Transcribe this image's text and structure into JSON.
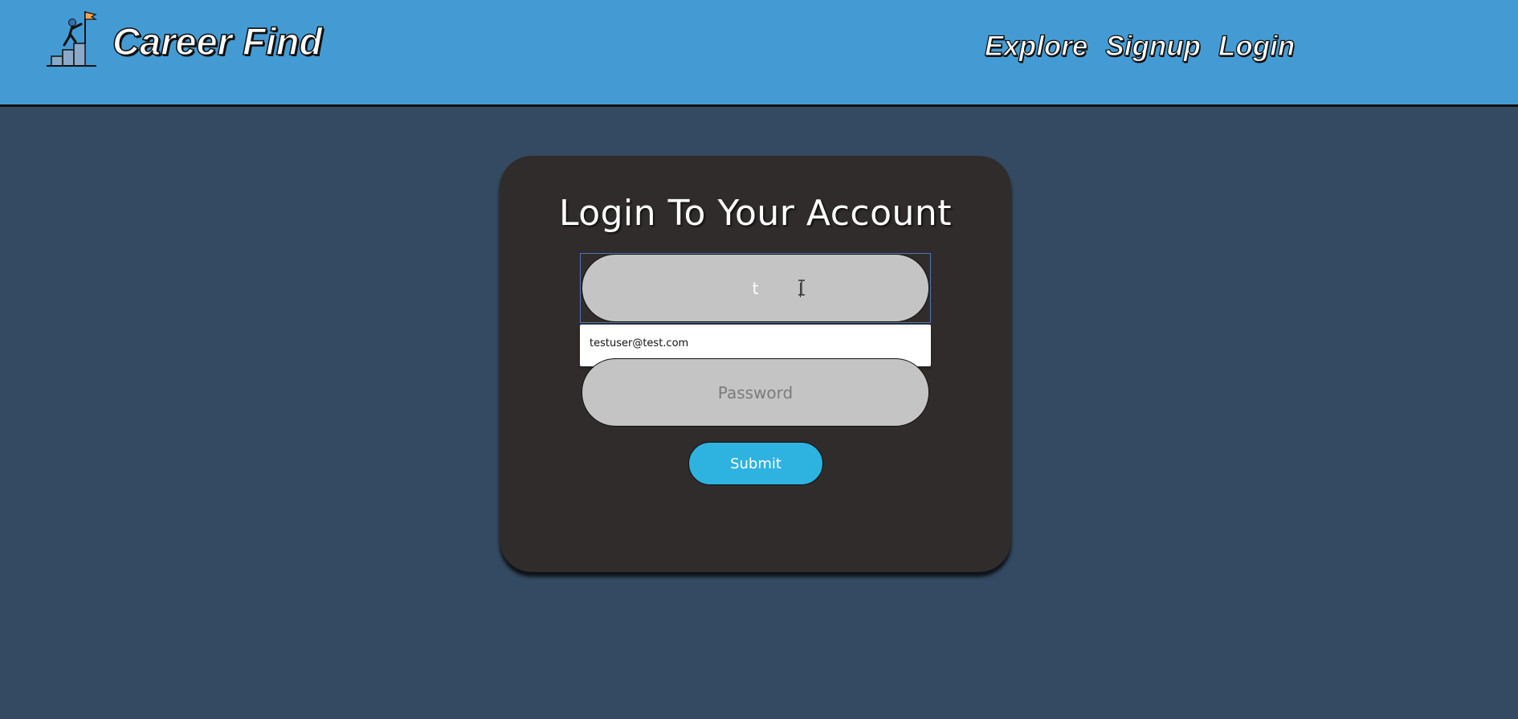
{
  "header": {
    "brand": "Career Find",
    "logo_icon": "career-ladder-flag-icon",
    "nav": [
      {
        "label": "Explore"
      },
      {
        "label": "Signup"
      },
      {
        "label": "Login"
      }
    ]
  },
  "login": {
    "title": "Login To Your Account",
    "email_value": "t",
    "password_placeholder": "Password",
    "submit_label": "Submit",
    "autocomplete": [
      "testuser@test.com"
    ]
  },
  "colors": {
    "header_bg": "#449bd3",
    "page_bg": "#344a62",
    "card_bg": "#302c2b",
    "input_bg": "#c4c4c4",
    "submit_bg": "#2eb2e0"
  }
}
